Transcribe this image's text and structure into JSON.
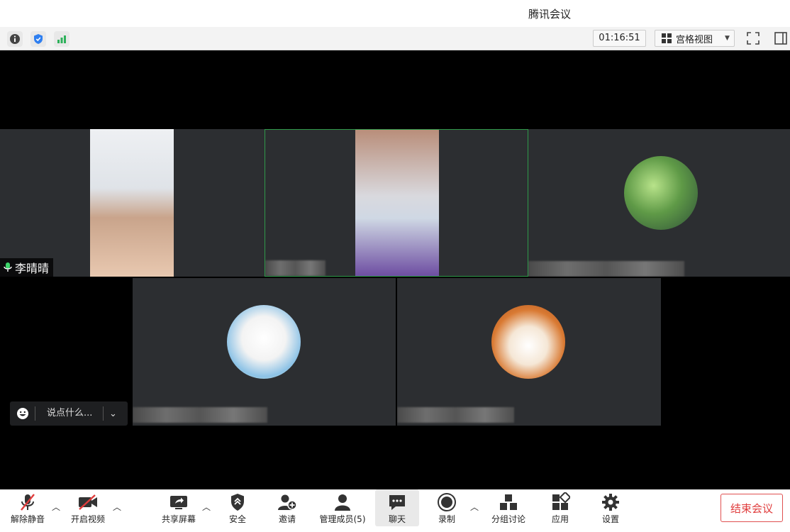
{
  "window": {
    "title": "腾讯会议"
  },
  "infobar": {
    "icons": [
      "info-icon",
      "shield-icon",
      "signal-icon"
    ],
    "timer": "01:16:51",
    "view_mode": "宫格视图"
  },
  "participants": [
    {
      "name": "李晴晴",
      "mic": "on",
      "tile": "video"
    },
    {
      "name": "",
      "tile": "video",
      "active_speaker": true
    },
    {
      "name": "",
      "tile": "avatar-leaf"
    },
    {
      "name": "",
      "tile": "avatar-doraemon"
    },
    {
      "name": "",
      "tile": "avatar-shiba"
    }
  ],
  "chat": {
    "placeholder": "说点什么..."
  },
  "toolbar": {
    "unmute": "解除静音",
    "video": "开启视频",
    "share": "共享屏幕",
    "security": "安全",
    "invite": "邀请",
    "members": "管理成员(5)",
    "chat": "聊天",
    "record": "录制",
    "breakout": "分组讨论",
    "apps": "应用",
    "settings": "设置",
    "end": "结束会议"
  },
  "colors": {
    "accent_green": "#2f9a4a",
    "end_red": "#e03c3c",
    "tile_bg": "#2c2e31"
  }
}
